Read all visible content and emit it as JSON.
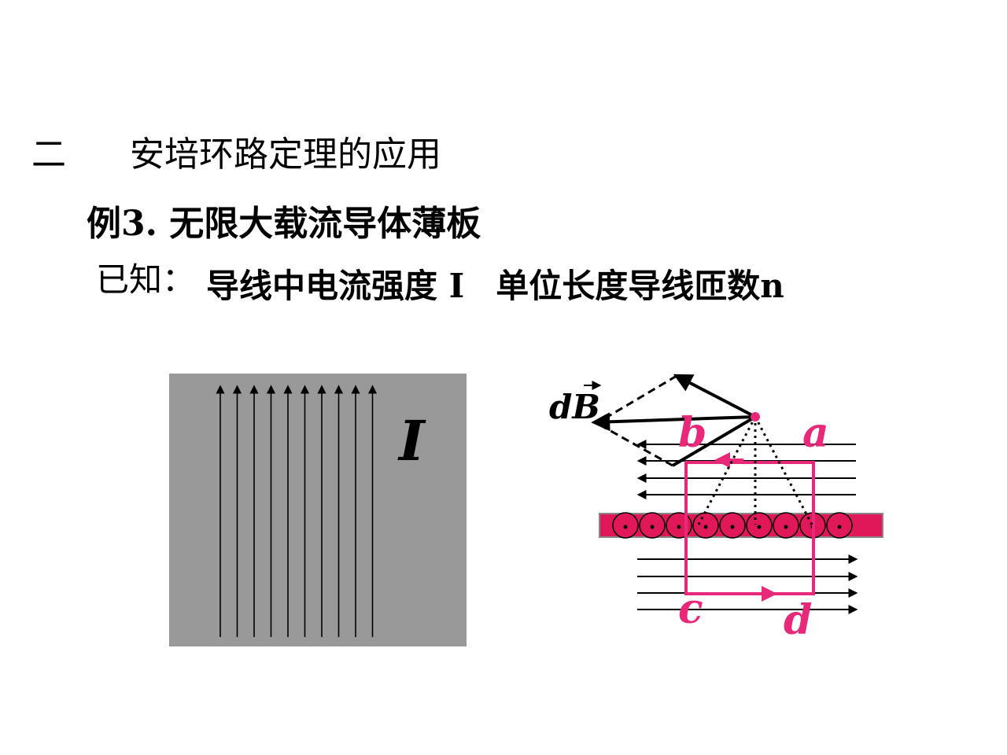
{
  "heading": {
    "number": "二",
    "title": "安培环路定理的应用"
  },
  "example": {
    "title": "例3. 无限大载流导体薄板"
  },
  "given": {
    "label": "已知：",
    "current_text": "导线中电流强度 I",
    "turns_text": "单位长度导线匝数n"
  },
  "plate_figure": {
    "current_label": "I",
    "plate_color": "#999999",
    "wire_count": 10
  },
  "field_figure": {
    "db_label": "dB",
    "point_labels": {
      "a": "a",
      "b": "b",
      "c": "c",
      "d": "d"
    },
    "accent_color": "#e8297a",
    "sheet_color": "#e0185a",
    "wire_count": 9
  }
}
